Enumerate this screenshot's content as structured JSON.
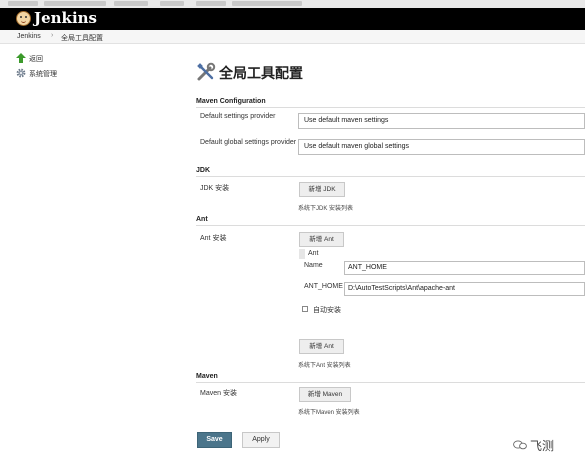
{
  "header": {
    "logo_text": "Jenkins"
  },
  "breadcrumb": {
    "root": "Jenkins",
    "separator": "›",
    "current": "全局工具配置"
  },
  "sidebar": {
    "items": [
      {
        "label": "返回",
        "icon": "up-arrow-icon"
      },
      {
        "label": "系统管理",
        "icon": "gear-icon"
      }
    ]
  },
  "page": {
    "title": "全局工具配置",
    "title_icon": "tools-icon"
  },
  "maven_configuration": {
    "heading": "Maven Configuration",
    "default_settings_label": "Default settings provider",
    "default_settings_value": "Use default maven settings",
    "default_global_label": "Default global settings provider",
    "default_global_value": "Use default maven global settings"
  },
  "jdk": {
    "heading": "JDK",
    "install_label": "JDK 安装",
    "add_button": "新增 JDK",
    "list_note": "系统下JDK 安装列表"
  },
  "ant": {
    "heading": "Ant",
    "install_label": "Ant 安装",
    "add_button": "新增 Ant",
    "item_title": "Ant",
    "name_label": "Name",
    "name_value": "ANT_HOME",
    "home_label": "ANT_HOME",
    "home_value": "D:\\AutoTestScripts\\Ant\\apache-ant",
    "auto_install_label": "自动安装",
    "auto_install_checked": false,
    "add_button_2": "新增 Ant",
    "list_note": "系统下Ant 安装列表"
  },
  "maven": {
    "heading": "Maven",
    "install_label": "Maven 安装",
    "add_button": "新增 Maven",
    "list_note": "系统下Maven 安装列表"
  },
  "footer": {
    "save_label": "Save",
    "apply_label": "Apply"
  },
  "watermark": {
    "text": "飞测",
    "icon": "wechat-icon"
  },
  "colors": {
    "header_bg": "#000000",
    "save_button": "#4b758b"
  }
}
